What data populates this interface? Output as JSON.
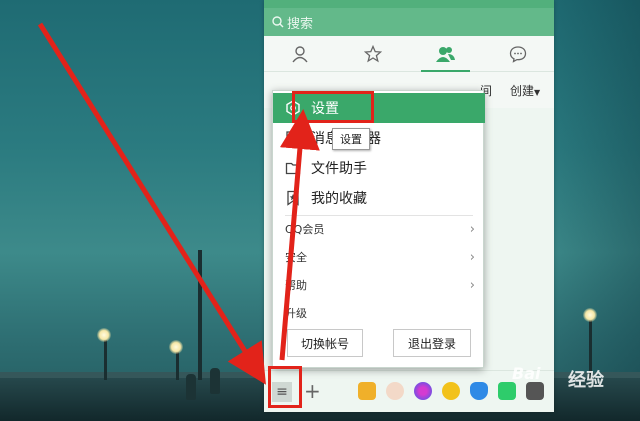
{
  "search": {
    "placeholder": "搜索"
  },
  "tabs": [
    {
      "icon": "person-icon"
    },
    {
      "icon": "star-icon"
    },
    {
      "icon": "contacts-icon",
      "active": true
    },
    {
      "icon": "chat-icon"
    }
  ],
  "subbar": {
    "recent": "间",
    "create": "创建"
  },
  "popup": {
    "main_items": [
      {
        "label": "设置",
        "icon": "hexagon-icon",
        "active": true
      },
      {
        "label": "消息管理器",
        "icon": "message-icon"
      },
      {
        "label": "文件助手",
        "icon": "folder-icon"
      },
      {
        "label": "我的收藏",
        "icon": "bookmark-icon"
      }
    ],
    "sub_items": [
      {
        "label": "QQ会员",
        "has_submenu": true
      },
      {
        "label": "安全",
        "has_submenu": true
      },
      {
        "label": "帮助",
        "has_submenu": true
      },
      {
        "label": "升级",
        "has_submenu": false
      }
    ],
    "switch_account": "切换帐号",
    "logout": "退出登录"
  },
  "tooltip": "设置",
  "toolbar": {
    "menu_icon": "menu-icon",
    "plus_icon": "plus-icon"
  },
  "watermark": {
    "logo": "Bai",
    "text": "经验"
  },
  "colors": {
    "accent": "#3aa86a",
    "header": "#52b07c",
    "annotation": "#e2231a"
  }
}
